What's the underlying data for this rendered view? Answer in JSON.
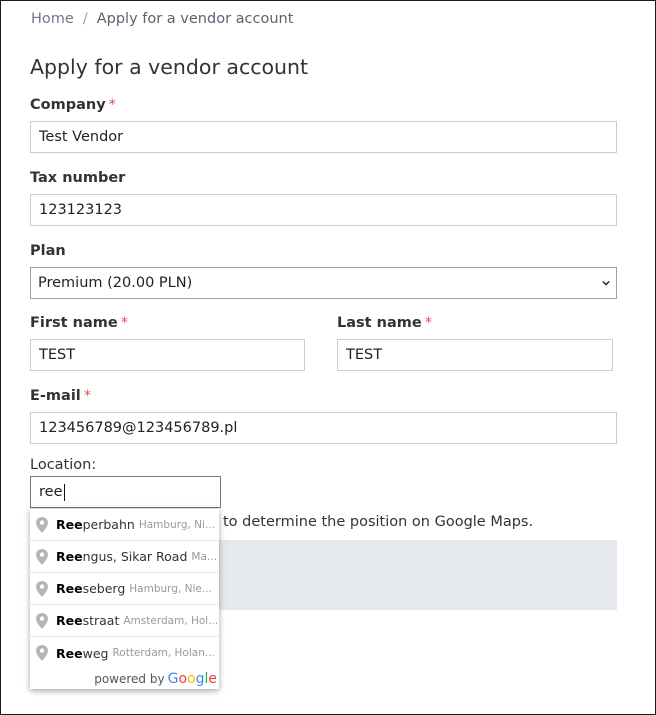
{
  "breadcrumb": {
    "home": "Home",
    "separator": "/",
    "current": "Apply for a vendor account"
  },
  "page": {
    "title": "Apply for a vendor account"
  },
  "form": {
    "required_mark": "*",
    "company": {
      "label": "Company",
      "value": "Test Vendor"
    },
    "tax_number": {
      "label": "Tax number",
      "value": "123123123"
    },
    "plan": {
      "label": "Plan",
      "selected": "Premium (20.00 PLN)"
    },
    "first_name": {
      "label": "First name",
      "value": "TEST"
    },
    "last_name": {
      "label": "Last name",
      "value": "TEST"
    },
    "email": {
      "label": "E-mail",
      "value": "123456789@123456789.pl"
    },
    "location": {
      "label": "Location:",
      "value": "ree",
      "hint": "to determine the position on Google Maps."
    }
  },
  "autocomplete": {
    "items": [
      {
        "match": "Ree",
        "rest": "perbahn",
        "secondary": "Hamburg, Ni..."
      },
      {
        "match": "Ree",
        "rest": "ngus, Sikar Road",
        "secondary": "Ma..."
      },
      {
        "match": "Ree",
        "rest": "seberg",
        "secondary": "Hamburg, Nie..."
      },
      {
        "match": "Ree",
        "rest": "straat",
        "secondary": "Amsterdam, Hol..."
      },
      {
        "match": "Ree",
        "rest": "weg",
        "secondary": "Rotterdam, Holan..."
      }
    ],
    "footer": "powered by",
    "brand": "Google"
  },
  "colors": {
    "required": "#d9534f",
    "map_placeholder": "#e5e8ec"
  }
}
